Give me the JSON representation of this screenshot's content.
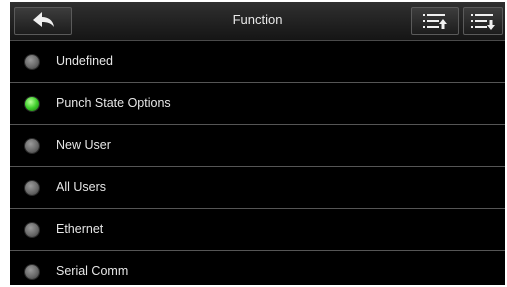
{
  "header": {
    "title": "Function"
  },
  "icons": {
    "back": "back-arrow-icon",
    "move_up": "list-up-icon",
    "move_down": "list-down-icon"
  },
  "colors": {
    "selected": "#3fcf2c",
    "unselected": "#6a6a6a"
  },
  "options": [
    {
      "label": "Undefined",
      "selected": false
    },
    {
      "label": "Punch State Options",
      "selected": true
    },
    {
      "label": "New User",
      "selected": false
    },
    {
      "label": "All Users",
      "selected": false
    },
    {
      "label": "Ethernet",
      "selected": false
    },
    {
      "label": "Serial Comm",
      "selected": false
    }
  ]
}
